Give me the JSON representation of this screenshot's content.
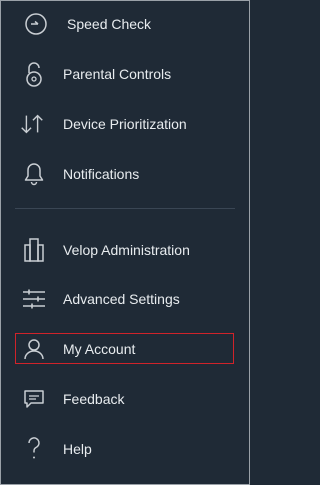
{
  "menu": {
    "items": [
      {
        "label": "Speed Check",
        "icon": "speedometer-icon"
      },
      {
        "label": "Parental Controls",
        "icon": "padlock-icon"
      },
      {
        "label": "Device Prioritization",
        "icon": "up-down-arrows-icon"
      },
      {
        "label": "Notifications",
        "icon": "bell-icon"
      },
      {
        "label": "Velop Administration",
        "icon": "velop-nodes-icon"
      },
      {
        "label": "Advanced Settings",
        "icon": "sliders-icon"
      },
      {
        "label": "My Account",
        "icon": "user-icon"
      },
      {
        "label": "Feedback",
        "icon": "chat-bubble-icon"
      },
      {
        "label": "Help",
        "icon": "question-mark-icon"
      }
    ],
    "selected": "My Account"
  },
  "colors": {
    "background": "#1f2a36",
    "text": "#e8ecef",
    "highlight_border": "#d0232a"
  }
}
